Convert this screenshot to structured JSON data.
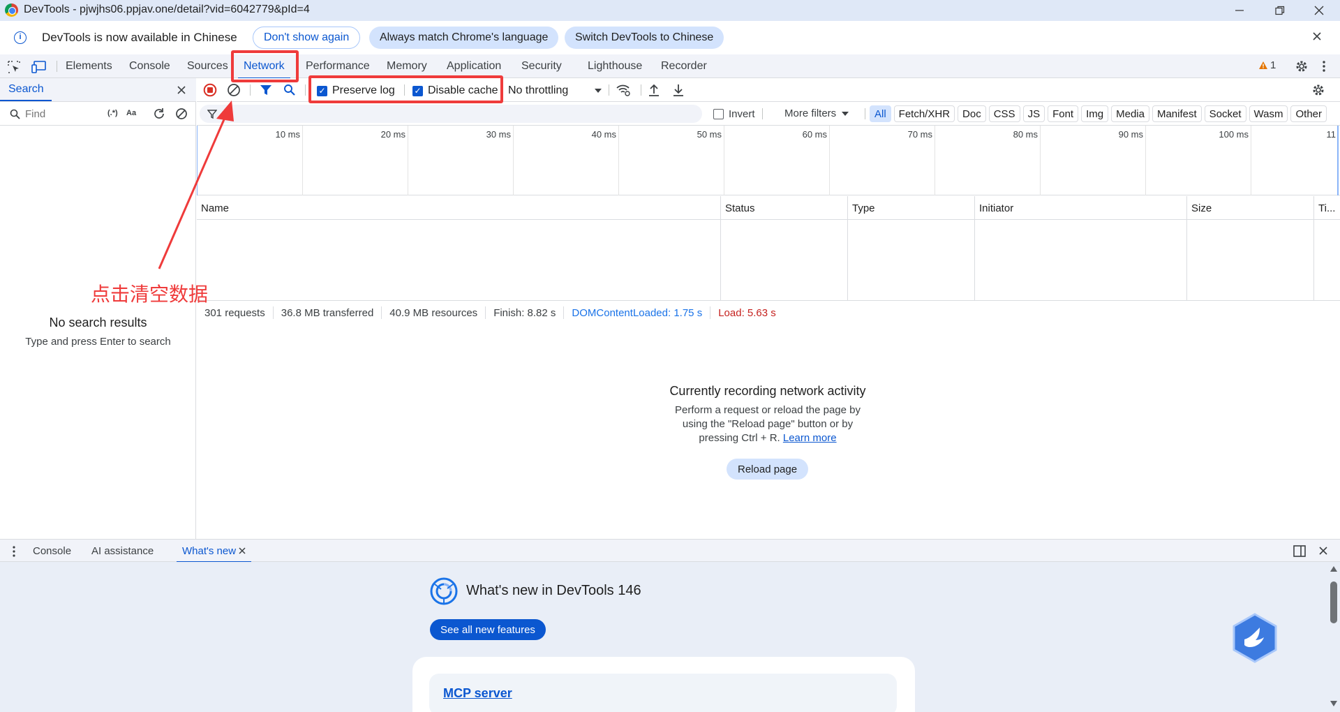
{
  "window": {
    "title": "DevTools - pjwjhs06.ppjav.one/detail?vid=6042779&pId=4",
    "controls": [
      "minimize",
      "restore",
      "close"
    ]
  },
  "infobar": {
    "message": "DevTools is now available in Chinese",
    "buttons": [
      "Don't show again",
      "Always match Chrome's language",
      "Switch DevTools to Chinese"
    ]
  },
  "devtools_tabs": [
    "Elements",
    "Console",
    "Sources",
    "Network",
    "Performance",
    "Memory",
    "Application",
    "Security",
    "Lighthouse",
    "Recorder"
  ],
  "active_tab": "Network",
  "warnings_count": "1",
  "search_pane": {
    "tab_label": "Search",
    "find_placeholder": "Find",
    "regex_label": "(.*)",
    "case_label": "Aa",
    "no_results_title": "No search results",
    "no_results_hint": "Type and press Enter to search"
  },
  "network_toolbar": {
    "preserve_log": "Preserve log",
    "disable_cache": "Disable cache",
    "throttling": "No throttling"
  },
  "filter_bar": {
    "invert": "Invert",
    "more_filters": "More filters",
    "types": [
      "All",
      "Fetch/XHR",
      "Doc",
      "CSS",
      "JS",
      "Font",
      "Img",
      "Media",
      "Manifest",
      "Socket",
      "Wasm",
      "Other"
    ]
  },
  "overview_ticks": [
    "10 ms",
    "20 ms",
    "30 ms",
    "40 ms",
    "50 ms",
    "60 ms",
    "70 ms",
    "80 ms",
    "90 ms",
    "100 ms",
    "11"
  ],
  "table_columns": [
    "Name",
    "Status",
    "Type",
    "Initiator",
    "Size",
    "Ti..."
  ],
  "summary": {
    "requests": "301 requests",
    "transferred": "36.8 MB transferred",
    "resources": "40.9 MB resources",
    "finish": "Finish: 8.82 s",
    "dom_content_loaded": "DOMContentLoaded: 1.75 s",
    "load": "Load: 5.63 s"
  },
  "recording": {
    "title": "Currently recording network activity",
    "line1": "Perform a request or reload the page by",
    "line2": "using the \"Reload page\" button or by",
    "line3": "pressing Ctrl + R.",
    "learn_more": "Learn more",
    "reload_button": "Reload page"
  },
  "drawer": {
    "tabs": [
      "Console",
      "AI assistance",
      "What's new"
    ],
    "active_tab": "What's new",
    "whats_new_title": "What's new in DevTools 146",
    "see_all_button": "See all new features",
    "card_link": "MCP server"
  },
  "annotation": {
    "text": "点击清空数据",
    "color": "#ef3b3b"
  },
  "colors": {
    "accent": "#0b57d0",
    "record_red": "#d93025",
    "dcl_blue": "#1a73e8",
    "load_red": "#c5221f"
  }
}
